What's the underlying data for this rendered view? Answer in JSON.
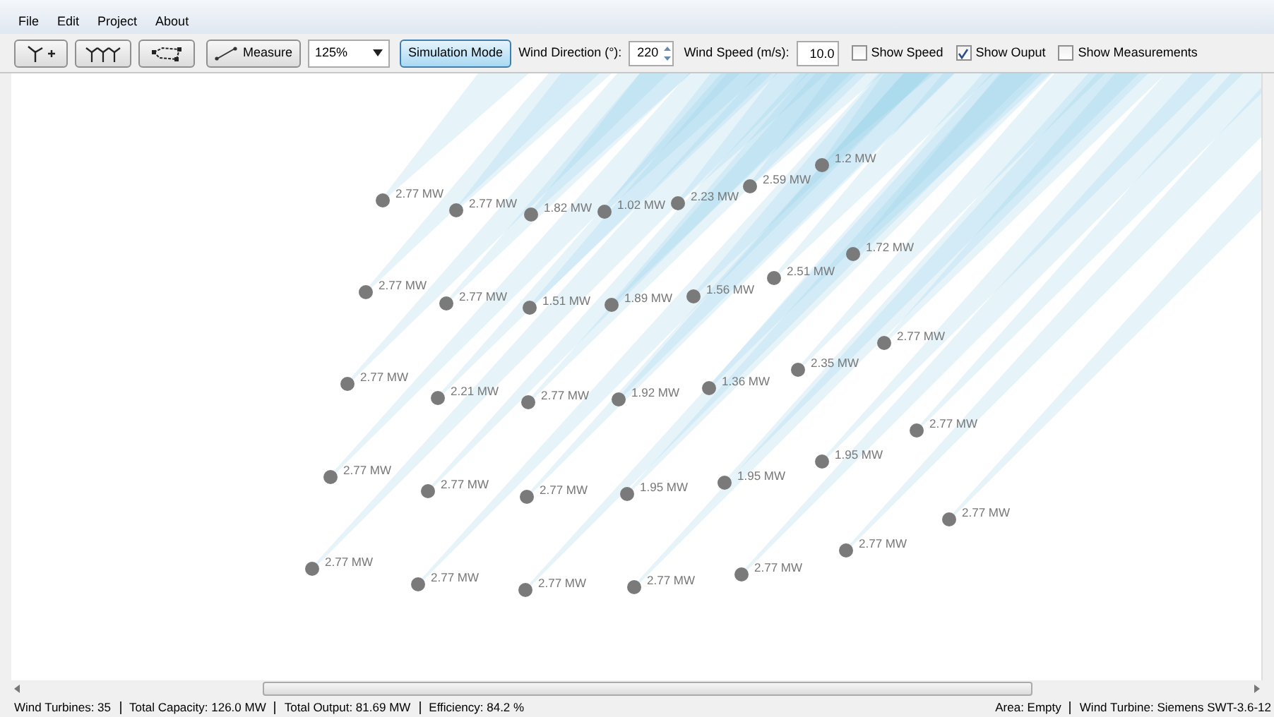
{
  "menu": [
    "File",
    "Edit",
    "Project",
    "About"
  ],
  "toolbar": {
    "measure_label": "Measure",
    "zoom": "125%",
    "simulation_mode": {
      "label": "Simulation Mode",
      "selected": true
    },
    "wind_direction": {
      "label": "Wind Direction (°):",
      "value": "220"
    },
    "wind_speed": {
      "label": "Wind Speed (m/s):",
      "value": "10.0"
    },
    "checkboxes": [
      {
        "label": "Show Speed",
        "checked": false
      },
      {
        "label": "Show Ouput",
        "checked": true
      },
      {
        "label": "Show Measurements",
        "checked": false
      }
    ]
  },
  "turbines": [
    {
      "output": "2.77 MW"
    },
    {
      "output": "2.77 MW"
    },
    {
      "output": "1.82 MW"
    },
    {
      "output": "1.02 MW"
    },
    {
      "output": "2.23 MW"
    },
    {
      "output": "2.59 MW"
    },
    {
      "output": "1.2 MW"
    },
    {
      "output": "2.77 MW"
    },
    {
      "output": "2.77 MW"
    },
    {
      "output": "1.51 MW"
    },
    {
      "output": "1.89 MW"
    },
    {
      "output": "1.56 MW"
    },
    {
      "output": "2.51 MW"
    },
    {
      "output": "1.72 MW"
    },
    {
      "output": "2.77 MW"
    },
    {
      "output": "2.21 MW"
    },
    {
      "output": "2.77 MW"
    },
    {
      "output": "1.92 MW"
    },
    {
      "output": "1.36 MW"
    },
    {
      "output": "2.35 MW"
    },
    {
      "output": "2.77 MW"
    },
    {
      "output": "2.77 MW"
    },
    {
      "output": "2.77 MW"
    },
    {
      "output": "2.77 MW"
    },
    {
      "output": "1.95 MW"
    },
    {
      "output": "1.95 MW"
    },
    {
      "output": "1.95 MW"
    },
    {
      "output": "2.77 MW"
    },
    {
      "output": "2.77 MW"
    },
    {
      "output": "2.77 MW"
    },
    {
      "output": "2.77 MW"
    },
    {
      "output": "2.77 MW"
    },
    {
      "output": "2.77 MW"
    },
    {
      "output": "2.77 MW"
    },
    {
      "output": "2.77 MW"
    }
  ],
  "status_bar": {
    "left": [
      "Wind Turbines: 35",
      "Total Capacity: 126.0 MW",
      "Total Output: 81.69 MW",
      "Efficiency: 84.2 %"
    ],
    "right": [
      "Area: Empty",
      "Wind Turbine: Siemens SWT-3.6-12"
    ]
  }
}
